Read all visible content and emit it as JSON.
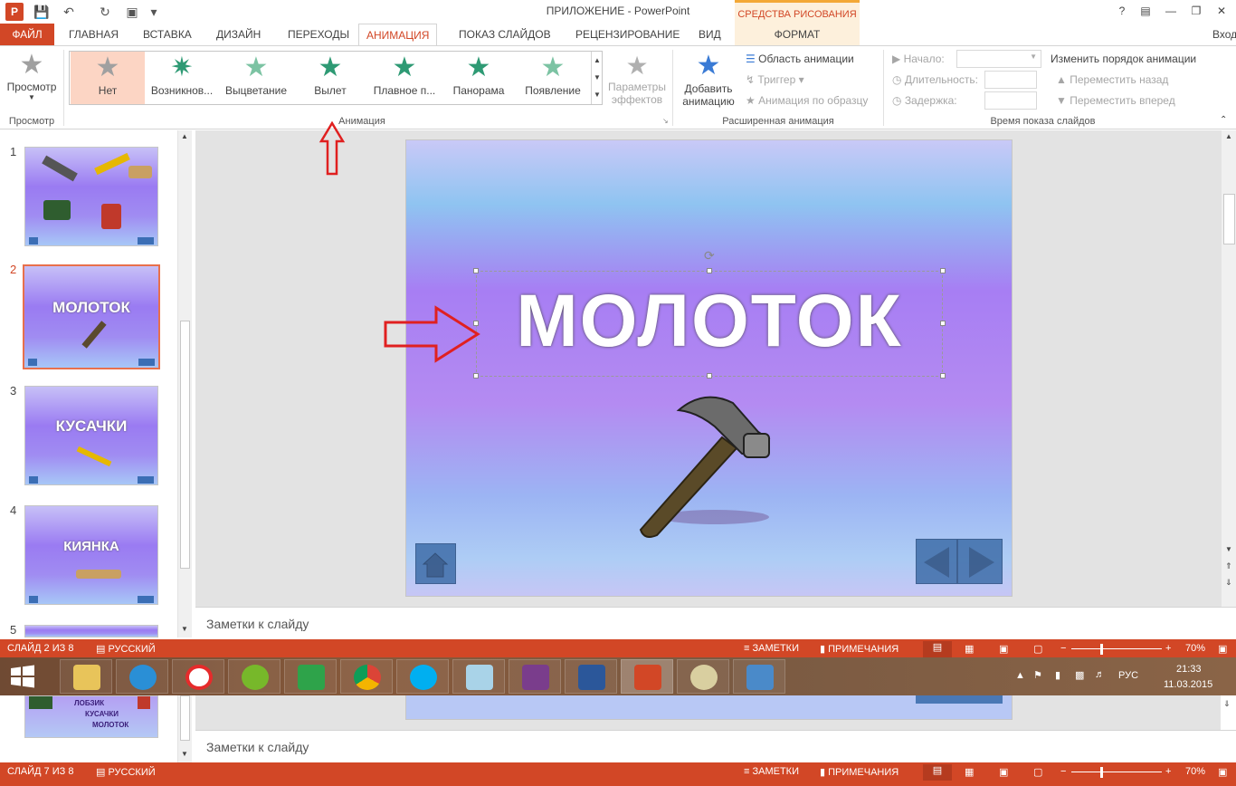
{
  "window": {
    "title": "ПРИЛОЖЕНИЕ - PowerPoint",
    "context_title": "СРЕДСТВА РИСОВАНИЯ",
    "help": "?",
    "signin": "Вход"
  },
  "quick_access": {
    "app_icon": "P"
  },
  "tabs": [
    {
      "label": "ФАЙЛ"
    },
    {
      "label": "ГЛАВНАЯ"
    },
    {
      "label": "ВСТАВКА"
    },
    {
      "label": "ДИЗАЙН"
    },
    {
      "label": "ПЕРЕХОДЫ"
    },
    {
      "label": "АНИМАЦИЯ"
    },
    {
      "label": "ПОКАЗ СЛАЙДОВ"
    },
    {
      "label": "РЕЦЕНЗИРОВАНИЕ"
    },
    {
      "label": "ВИД"
    },
    {
      "label": "ФОРМАТ"
    }
  ],
  "ribbon": {
    "preview_button": "Просмотр",
    "preview_group": "Просмотр",
    "gallery": [
      {
        "label": "Нет",
        "icon": "star-icon"
      },
      {
        "label": "Возникнов...",
        "icon": "star-appear-icon"
      },
      {
        "label": "Выцветание",
        "icon": "star-fade-icon"
      },
      {
        "label": "Вылет",
        "icon": "star-fly-icon"
      },
      {
        "label": "Плавное п...",
        "icon": "star-float-icon"
      },
      {
        "label": "Панорама",
        "icon": "star-split-icon"
      },
      {
        "label": "Появление",
        "icon": "star-wipe-icon"
      }
    ],
    "effect_options_1": "Параметры",
    "effect_options_2": "эффектов",
    "animation_group": "Анимация",
    "add_animation_1": "Добавить",
    "add_animation_2": "анимацию",
    "animation_pane": "Область анимации",
    "trigger": "Триггер",
    "animation_painter": "Анимация по образцу",
    "advanced_group": "Расширенная анимация",
    "start_label": "Начало:",
    "duration_label": "Длительность:",
    "delay_label": "Задержка:",
    "reorder_title": "Изменить порядок анимации",
    "move_earlier": "Переместить назад",
    "move_later": "Переместить вперед",
    "timing_group": "Время показа слайдов"
  },
  "slides": [
    {
      "num": "1",
      "title": ""
    },
    {
      "num": "2",
      "title": "МОЛОТОК"
    },
    {
      "num": "3",
      "title": "КУСАЧКИ"
    },
    {
      "num": "4",
      "title": "КИЯНКА"
    },
    {
      "num": "5",
      "title": ""
    }
  ],
  "ghost_slide": {
    "lines": [
      "ЛОБЗИК",
      "КУСАЧКИ",
      "МОЛОТОК"
    ]
  },
  "slide": {
    "title": "МОЛОТОК"
  },
  "notes": {
    "placeholder": "Заметки к слайду"
  },
  "status": {
    "slide_info": "СЛАЙД 2 ИЗ 8",
    "language": "РУССКИЙ",
    "notes": "ЗАМЕТКИ",
    "comments": "ПРИМЕЧАНИЯ",
    "zoom": "70%"
  },
  "status2": {
    "slide_info": "СЛАЙД 7 ИЗ 8",
    "language": "РУССКИЙ",
    "notes": "ЗАМЕТКИ",
    "comments": "ПРИМЕЧАНИЯ",
    "zoom": "70%"
  },
  "notes2": {
    "placeholder": "Заметки к слайду"
  },
  "taskbar": {
    "apps": [
      "file-explorer-icon",
      "ie-icon",
      "yandex-icon",
      "utorrent-icon",
      "mail-agent-icon",
      "chrome-icon",
      "skype-icon",
      "notepad-icon",
      "winrar-icon",
      "word-icon",
      "powerpoint-icon",
      "paint-icon",
      "photo-icon"
    ],
    "lang": "РУС",
    "time": "21:33",
    "date": "11.03.2015"
  },
  "colors": {
    "accent": "#d24726",
    "context": "#f3a836"
  }
}
